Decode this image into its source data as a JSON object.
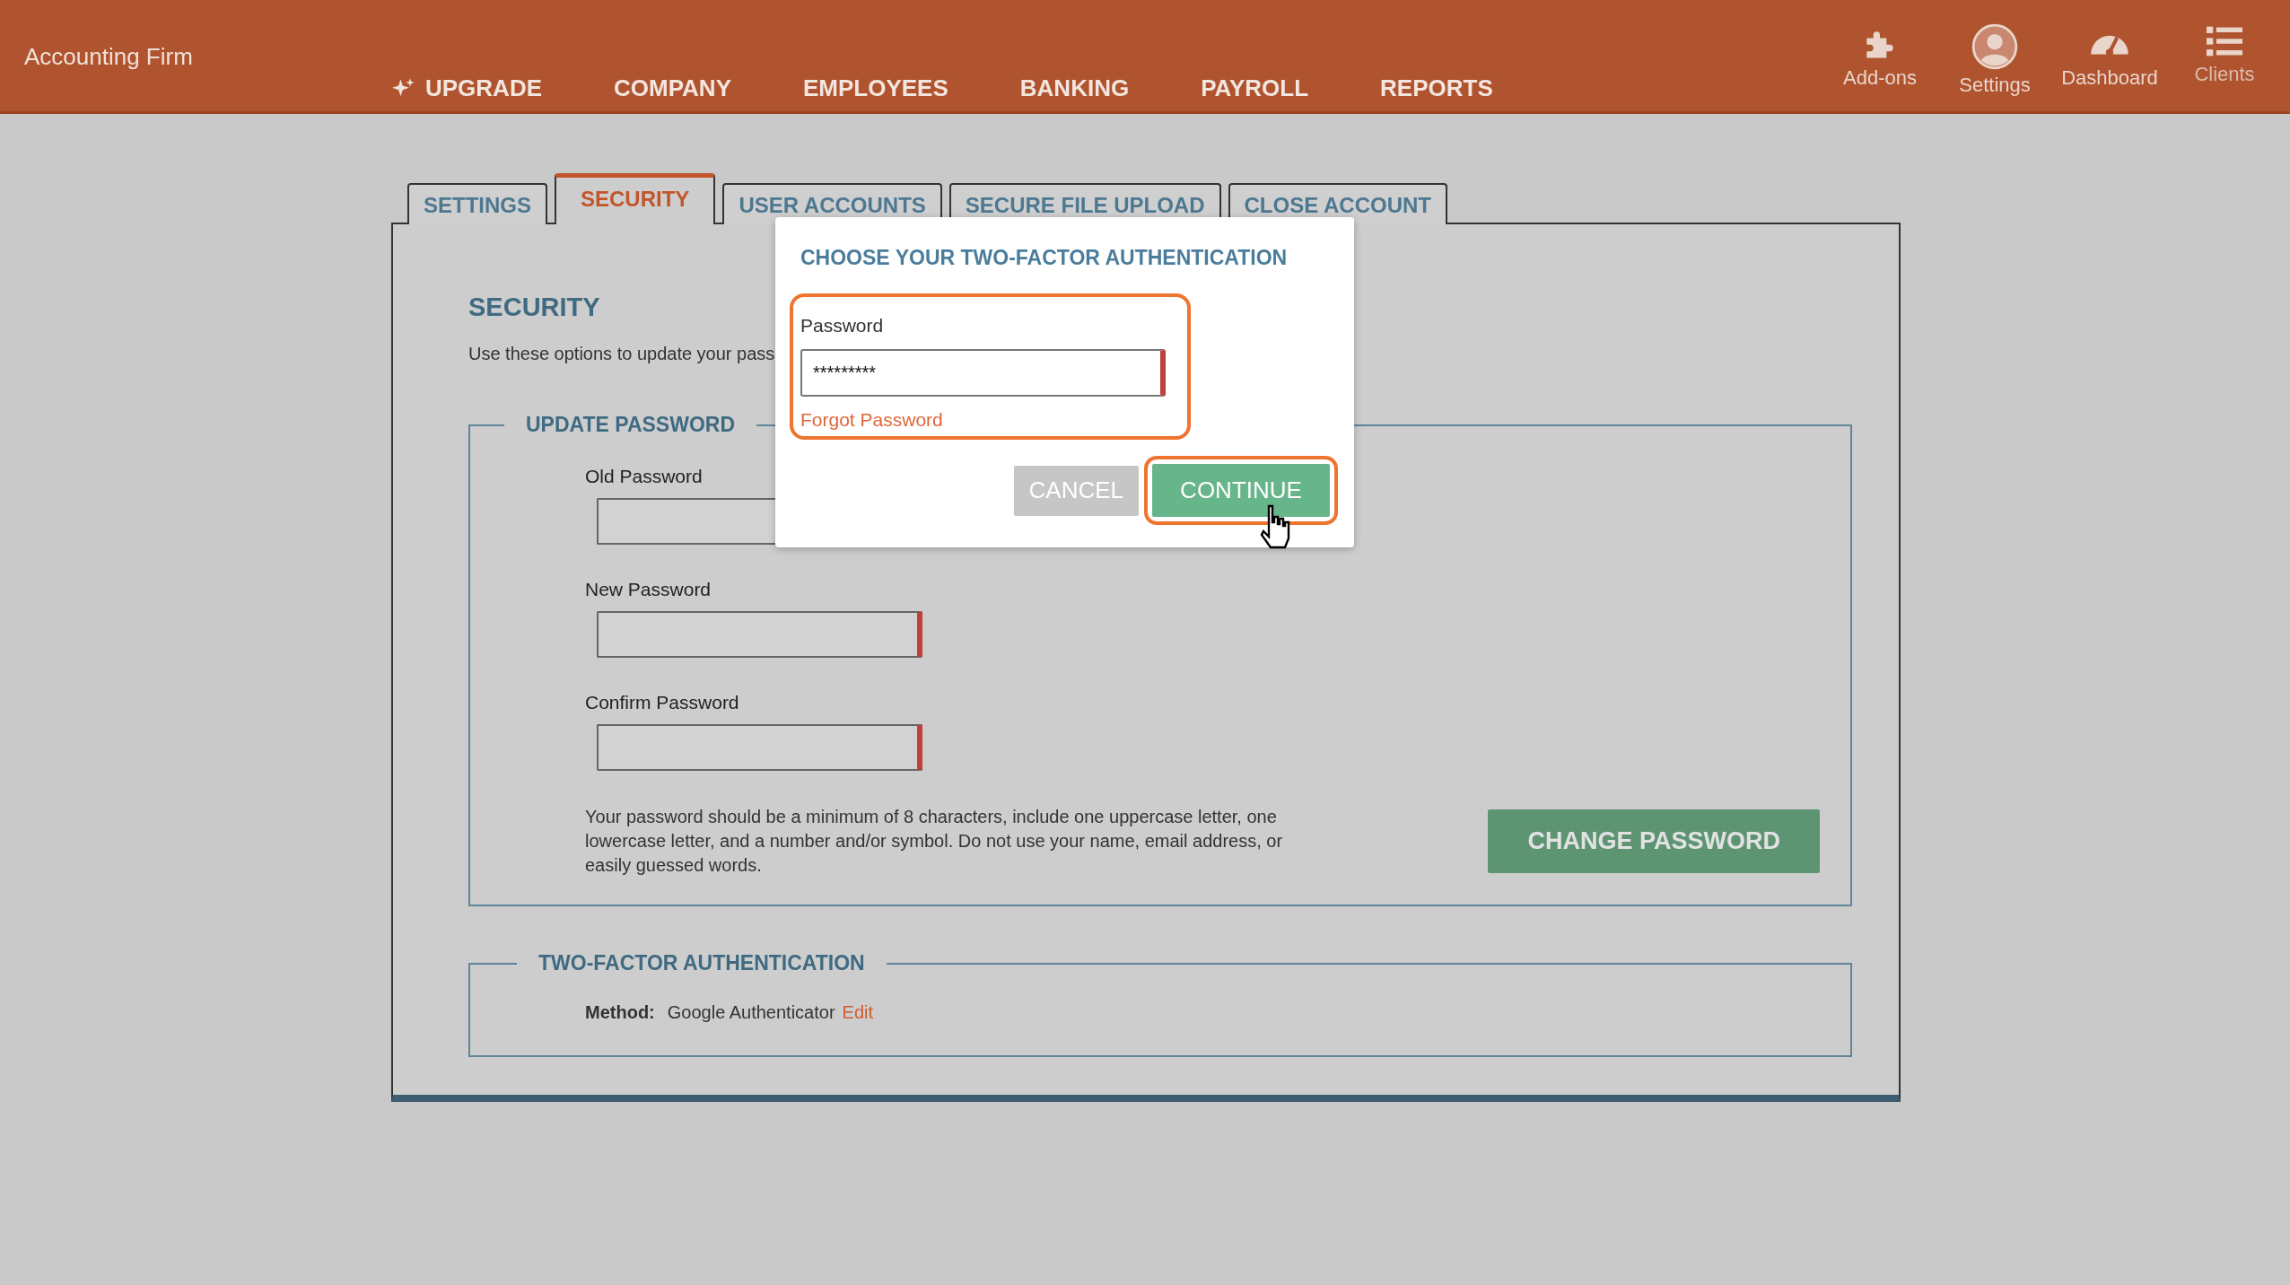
{
  "header": {
    "brand": "Accounting Firm",
    "nav": [
      {
        "label": "UPGRADE",
        "kind": "upgrade"
      },
      {
        "label": "COMPANY",
        "kind": "link"
      },
      {
        "label": "EMPLOYEES",
        "kind": "link"
      },
      {
        "label": "BANKING",
        "kind": "link"
      },
      {
        "label": "PAYROLL",
        "kind": "link"
      },
      {
        "label": "REPORTS",
        "kind": "link"
      }
    ],
    "shortcuts": [
      {
        "label": "Add-ons",
        "kind": "puzzle"
      },
      {
        "label": "Settings",
        "kind": "user"
      },
      {
        "label": "Dashboard",
        "kind": "gauge"
      },
      {
        "label": "Clients",
        "kind": "list"
      }
    ]
  },
  "tabs": [
    {
      "label": "SETTINGS",
      "selected": false
    },
    {
      "label": "SECURITY",
      "selected": true
    },
    {
      "label": "USER ACCOUNTS",
      "selected": false
    },
    {
      "label": "SECURE FILE UPLOAD",
      "selected": false
    },
    {
      "label": "CLOSE ACCOUNT",
      "selected": false
    }
  ],
  "security": {
    "title": "SECURITY",
    "description": "Use these options to update your pass",
    "update_password": {
      "legend": "UPDATE PASSWORD",
      "fields": [
        {
          "label": "Old Password"
        },
        {
          "label": "New Password"
        },
        {
          "label": "Confirm Password"
        }
      ],
      "hint": "Your password should be a minimum of 8 characters, include one uppercase letter, one lowercase letter, and a number and/or symbol. Do not use your name, email address, or easily guessed words.",
      "button": "CHANGE PASSWORD"
    },
    "two_factor": {
      "legend": "TWO-FACTOR AUTHENTICATION",
      "method_label": "Method:",
      "method_value": "Google Authenticator",
      "edit_link": "Edit"
    }
  },
  "dialog": {
    "title": "CHOOSE YOUR TWO-FACTOR AUTHENTICATION",
    "password": {
      "label": "Password",
      "value": "*********",
      "highlighted": true
    },
    "forgot_link": "Forgot Password",
    "buttons": [
      {
        "label": "CANCEL",
        "kind": "secondary",
        "highlighted": false
      },
      {
        "label": "CONTINUE",
        "kind": "primary",
        "highlighted": true
      }
    ]
  }
}
